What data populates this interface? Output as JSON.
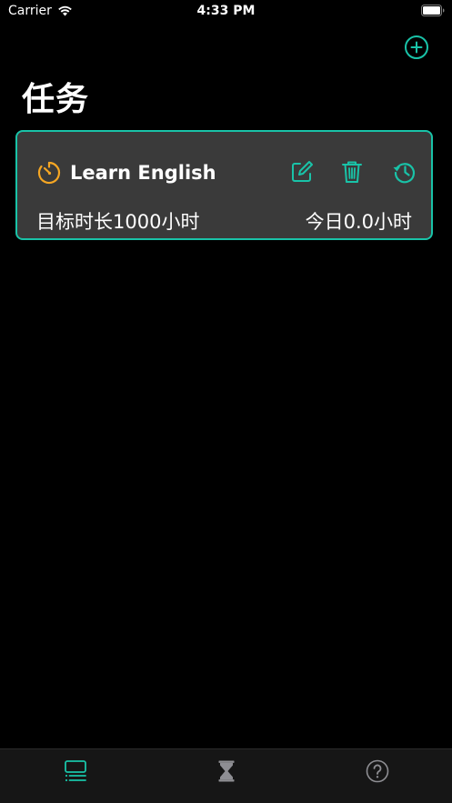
{
  "status_bar": {
    "carrier": "Carrier",
    "time": "4:33 PM"
  },
  "nav": {
    "title": "任务",
    "add_icon": "plus-circle-icon"
  },
  "tasks": [
    {
      "name": "Learn English",
      "icon": "timer-icon",
      "target": "目标时长1000小时",
      "today": "今日0.0小时",
      "actions": [
        "edit-icon",
        "trash-icon",
        "history-icon"
      ]
    }
  ],
  "tab_bar": {
    "items": [
      {
        "icon": "task-list-icon",
        "selected": true
      },
      {
        "icon": "hourglass-icon",
        "selected": false
      },
      {
        "icon": "help-icon",
        "selected": false
      }
    ]
  },
  "colors": {
    "accent": "#19c3a8",
    "timer_orange": "#f5a623",
    "background": "#000000",
    "card_background": "#3a3a3a",
    "tab_inactive": "#8e8e93"
  }
}
